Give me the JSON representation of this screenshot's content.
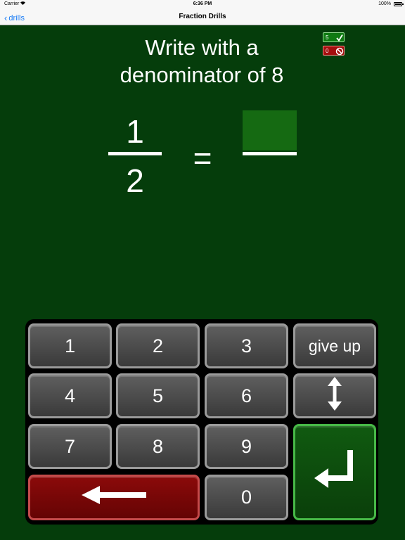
{
  "status_bar": {
    "carrier": "Carrier",
    "time": "6:36 PM",
    "battery": "100%"
  },
  "nav": {
    "back_label": "drills",
    "title": "Fraction Drills"
  },
  "question": {
    "line1": "Write with a",
    "line2": "denominator of 8"
  },
  "score": {
    "correct": "5",
    "wrong": "0"
  },
  "fraction": {
    "numerator": "1",
    "denominator": "2",
    "equals": "="
  },
  "keypad": {
    "keys": [
      "1",
      "2",
      "3",
      "give up",
      "4",
      "5",
      "6",
      "7",
      "8",
      "9",
      "0"
    ]
  },
  "colors": {
    "background": "#053d0b",
    "key_gray": "#4a4a4a",
    "key_red": "#7a0707",
    "key_green": "#0d4d0d",
    "ios_blue": "#1a7cf6"
  },
  "icons": {
    "check": "check-icon",
    "no": "prohibited-icon",
    "up_down": "up-down-arrow-icon",
    "backspace": "left-arrow-icon",
    "enter": "return-arrow-icon"
  }
}
